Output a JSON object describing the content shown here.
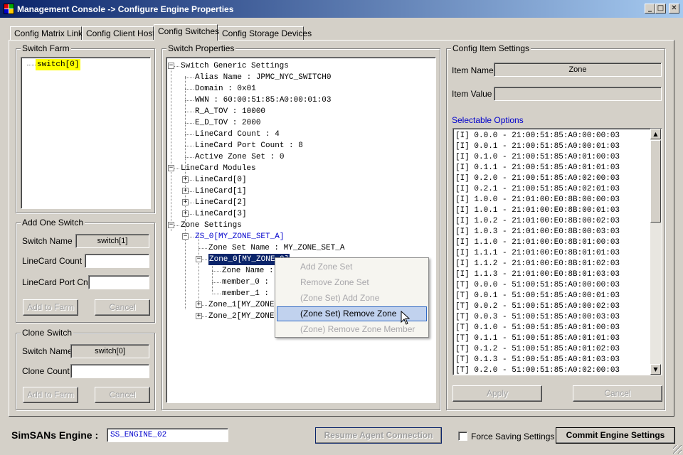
{
  "window": {
    "title": "Management Console -> Configure Engine Properties",
    "min": "_",
    "max": "□",
    "close": "✕"
  },
  "tabs": [
    {
      "label": "Config Matrix Links"
    },
    {
      "label": "Config Client Hosts"
    },
    {
      "label": "Config Switches"
    },
    {
      "label": "Config Storage Devices"
    }
  ],
  "switch_farm": {
    "legend": "Switch Farm",
    "items": [
      "switch[0]"
    ]
  },
  "add_switch": {
    "legend": "Add One Switch",
    "name_label": "Switch Name",
    "name_value": "switch[1]",
    "linecard_label": "LineCard Count",
    "linecard_value": "",
    "port_label": "LineCard Port Cnt",
    "port_value": "",
    "add_btn": "Add to Farm",
    "cancel_btn": "Cancel"
  },
  "clone_switch": {
    "legend": "Clone Switch",
    "name_label": "Switch Name",
    "name_value": "switch[0]",
    "count_label": "Clone Count",
    "count_value": "",
    "add_btn": "Add to Farm",
    "cancel_btn": "Cancel"
  },
  "switch_properties": {
    "legend": "Switch Properties",
    "tree": [
      "Switch Generic Settings",
      "Alias Name : JPMC_NYC_SWITCH0",
      "Domain : 0x01",
      "WWN : 60:00:51:85:A0:00:01:03",
      "R_A_TOV : 10000",
      "E_D_TOV : 2000",
      "LineCard Count : 4",
      "LineCard Port Count : 8",
      "Active Zone Set : 0",
      "LineCard Modules",
      "LineCard[0]",
      "LineCard[1]",
      "LineCard[2]",
      "LineCard[3]",
      "Zone Settings",
      "ZS_0[MY_ZONE_SET_A]",
      "Zone Set Name : MY_ZONE_SET_A",
      "Zone_0[MY_ZONE_0]",
      "Zone Name :",
      "member_0 :",
      "member_1 :",
      "Zone_1[MY_ZONE",
      "Zone_2[MY_ZONE"
    ]
  },
  "context_menu": {
    "items": [
      "Add Zone Set",
      "Remove Zone Set",
      "(Zone Set) Add Zone",
      "(Zone Set) Remove Zone",
      "(Zone) Remove Zone Member"
    ],
    "hovered_index": 3
  },
  "item_settings": {
    "legend": "Config Item Settings",
    "name_label": "Item Name",
    "name_value": "Zone",
    "value_label": "Item Value",
    "value_value": "",
    "options_label": "Selectable Options",
    "options": [
      "[I] 0.0.0 - 21:00:51:85:A0:00:00:03",
      "[I] 0.0.1 - 21:00:51:85:A0:00:01:03",
      "[I] 0.1.0 - 21:00:51:85:A0:01:00:03",
      "[I] 0.1.1 - 21:00:51:85:A0:01:01:03",
      "[I] 0.2.0 - 21:00:51:85:A0:02:00:03",
      "[I] 0.2.1 - 21:00:51:85:A0:02:01:03",
      "[I] 1.0.0 - 21:01:00:E0:8B:00:00:03",
      "[I] 1.0.1 - 21:01:00:E0:8B:00:01:03",
      "[I] 1.0.2 - 21:01:00:E0:8B:00:02:03",
      "[I] 1.0.3 - 21:01:00:E0:8B:00:03:03",
      "[I] 1.1.0 - 21:01:00:E0:8B:01:00:03",
      "[I] 1.1.1 - 21:01:00:E0:8B:01:01:03",
      "[I] 1.1.2 - 21:01:00:E0:8B:01:02:03",
      "[I] 1.1.3 - 21:01:00:E0:8B:01:03:03",
      "[T] 0.0.0 - 51:00:51:85:A0:00:00:03",
      "[T] 0.0.1 - 51:00:51:85:A0:00:01:03",
      "[T] 0.0.2 - 51:00:51:85:A0:00:02:03",
      "[T] 0.0.3 - 51:00:51:85:A0:00:03:03",
      "[T] 0.1.0 - 51:00:51:85:A0:01:00:03",
      "[T] 0.1.1 - 51:00:51:85:A0:01:01:03",
      "[T] 0.1.2 - 51:00:51:85:A0:01:02:03",
      "[T] 0.1.3 - 51:00:51:85:A0:01:03:03",
      "[T] 0.2.0 - 51:00:51:85:A0:02:00:03"
    ],
    "apply_btn": "Apply",
    "cancel_btn": "Cancel"
  },
  "footer": {
    "engine_label": "SimSANs Engine :",
    "engine_value": "SS_ENGINE_02",
    "resume_btn": "Resume Agent Connection",
    "force_label": "Force Saving Settings",
    "commit_btn": "Commit Engine Settings"
  },
  "colors": {
    "title_start": "#0a246a",
    "title_end": "#a6caf0",
    "selection": "#0a246a",
    "highlight": "#ffff00",
    "link_text": "#0000cc"
  }
}
